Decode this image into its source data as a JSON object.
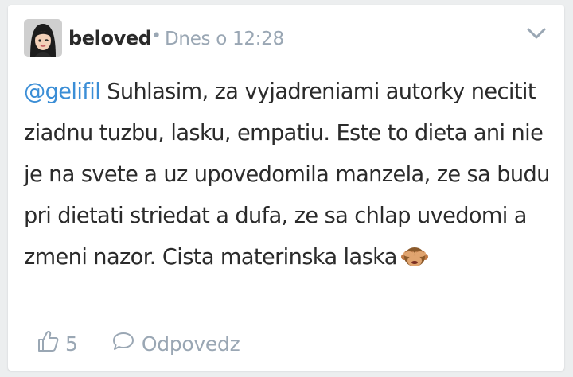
{
  "post": {
    "author": "beloved",
    "separator": "•",
    "timestamp": "Dnes o 12:28",
    "mention": "@gelifil",
    "text": " Suhlasim, za vyjadreniami autorky necitit ziadnu tuzbu, lasku, empatiu. Este to dieta ani nie je na svete a uz upovedomila manzela, ze sa budu pri dietati striedat a dufa, ze sa chlap uvedomi a zmeni nazor. Cista materinska laska",
    "emoji": "see-no-evil-monkey"
  },
  "actions": {
    "like_count": "5",
    "reply_label": "Odpovedz"
  },
  "icons": {
    "menu": "chevron-down-icon",
    "like": "thumbs-up-icon",
    "reply": "speech-bubble-icon"
  },
  "colors": {
    "mention": "#3b8ed6",
    "meta": "#9aa7b4",
    "text": "#2b2b2b",
    "background": "#eceeef",
    "card": "#ffffff"
  }
}
